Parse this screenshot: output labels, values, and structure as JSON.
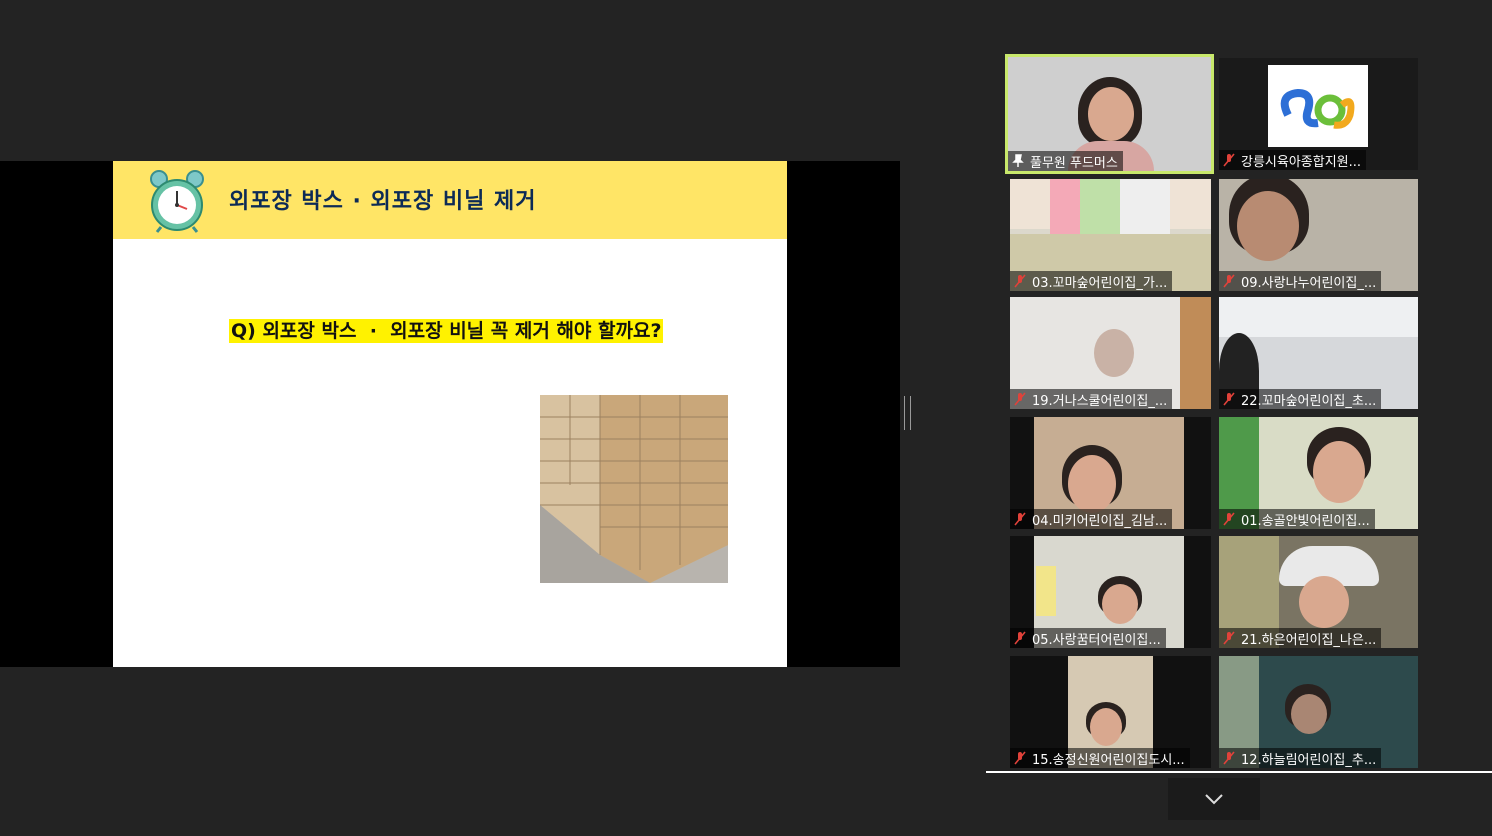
{
  "slide": {
    "title": "외포장 박스 · 외포장 비닐 제거",
    "question": "Q) 외포장 박스  ·  외포장 비닐 꼭 제거 해야 할까요?"
  },
  "participants": [
    {
      "name": "풀무원 푸드머스",
      "icon": "spotlight-pin-icon"
    },
    {
      "name": "강릉시육아종합지원...",
      "icon": "muted-mic-icon"
    },
    {
      "name": "03.꼬마숲어린이집_가...",
      "icon": "muted-mic-icon"
    },
    {
      "name": "09.사랑나누어린이집_...",
      "icon": "muted-mic-icon"
    },
    {
      "name": "19.거나스쿨어린이집_...",
      "icon": "muted-mic-icon"
    },
    {
      "name": "22.꼬마숲어린이집_초...",
      "icon": "muted-mic-icon"
    },
    {
      "name": "04.미키어린이집_김남...",
      "icon": "muted-mic-icon"
    },
    {
      "name": "01.송골안빛어린이집...",
      "icon": "muted-mic-icon"
    },
    {
      "name": "05.사랑꿈터어린이집...",
      "icon": "muted-mic-icon"
    },
    {
      "name": "21.하은어린이집_나은...",
      "icon": "muted-mic-icon"
    },
    {
      "name": "15.송정신원어린이집도시...",
      "icon": "muted-mic-icon"
    },
    {
      "name": "12.하늘림어린이집_추...",
      "icon": "muted-mic-icon"
    }
  ],
  "colors": {
    "active_speaker_border": "#c8e86b",
    "slide_header": "#ffe566",
    "highlight": "#fff200",
    "mute_icon": "#e0423a"
  }
}
